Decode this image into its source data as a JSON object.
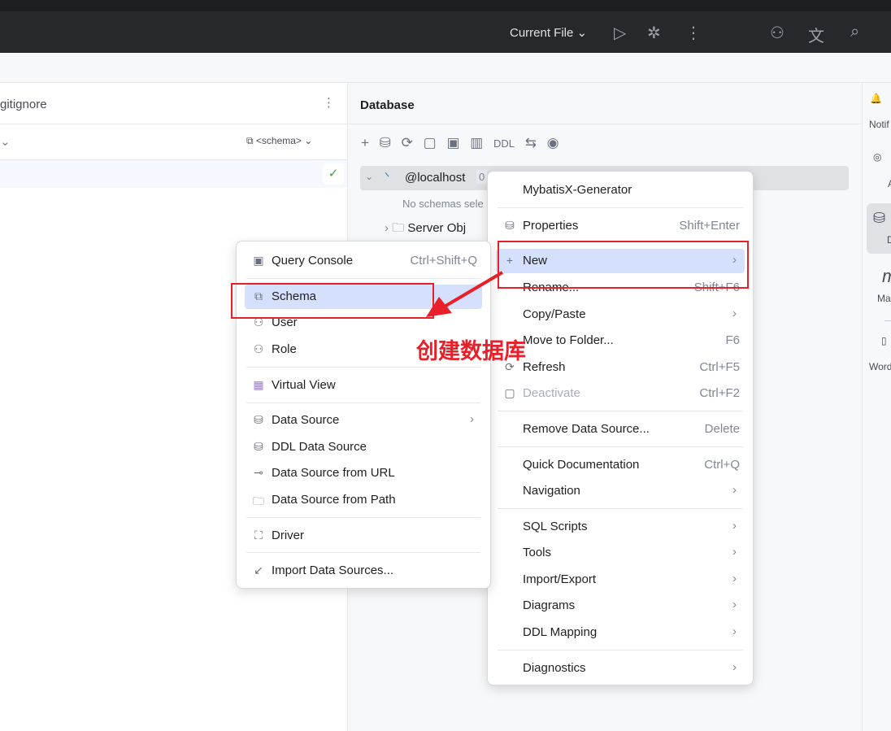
{
  "topbar": {
    "run_config": "Current File",
    "icons": [
      "chevron-down-icon",
      "run-icon",
      "debug-icon",
      "more-icon",
      "add-user-icon",
      "translate-icon",
      "search-icon"
    ]
  },
  "left_panel": {
    "file": "gitignore",
    "schema_selector": "<schema>"
  },
  "database_panel": {
    "title": "Database",
    "toolbar": [
      "add-icon",
      "data-source-properties-icon",
      "refresh-icon",
      "deactivate-icon",
      "query-console-icon",
      "table-icon",
      "DDL",
      "jump-icon",
      "view-options-icon"
    ],
    "tree": {
      "connection": "@localhost",
      "badge": "0",
      "no_schemas": "No schemas sele",
      "server_objects": "Server Obj"
    }
  },
  "right_sidebar": [
    "Notif",
    "A",
    "D",
    "Ma",
    "Word"
  ],
  "context_menu": {
    "items": [
      {
        "label": "MybatisX-Generator",
        "shortcut": ""
      },
      {
        "label": "Properties",
        "shortcut": "Shift+Enter"
      },
      {
        "label": "New",
        "shortcut": ""
      },
      {
        "label": "Rename...",
        "shortcut": "Shift+F6"
      },
      {
        "label": "Copy/Paste",
        "shortcut": ""
      },
      {
        "label": "Move to Folder...",
        "shortcut": "F6"
      },
      {
        "label": "Refresh",
        "shortcut": "Ctrl+F5"
      },
      {
        "label": "Deactivate",
        "shortcut": "Ctrl+F2"
      },
      {
        "label": "Remove Data Source...",
        "shortcut": "Delete"
      },
      {
        "label": "Quick Documentation",
        "shortcut": "Ctrl+Q"
      },
      {
        "label": "Navigation",
        "shortcut": ""
      },
      {
        "label": "SQL Scripts",
        "shortcut": ""
      },
      {
        "label": "Tools",
        "shortcut": ""
      },
      {
        "label": "Import/Export",
        "shortcut": ""
      },
      {
        "label": "Diagrams",
        "shortcut": ""
      },
      {
        "label": "DDL Mapping",
        "shortcut": ""
      },
      {
        "label": "Diagnostics",
        "shortcut": ""
      }
    ]
  },
  "new_submenu": {
    "items": [
      {
        "label": "Query Console",
        "shortcut": "Ctrl+Shift+Q"
      },
      {
        "label": "Schema"
      },
      {
        "label": "User"
      },
      {
        "label": "Role"
      },
      {
        "label": "Virtual View"
      },
      {
        "label": "Data Source"
      },
      {
        "label": "DDL Data Source"
      },
      {
        "label": "Data Source from URL"
      },
      {
        "label": "Data Source from Path"
      },
      {
        "label": "Driver"
      },
      {
        "label": "Import Data Sources..."
      }
    ]
  },
  "annotation": "创建数据库",
  "colors": {
    "accent": "#d5e1fc",
    "annotation": "#e8202a"
  }
}
